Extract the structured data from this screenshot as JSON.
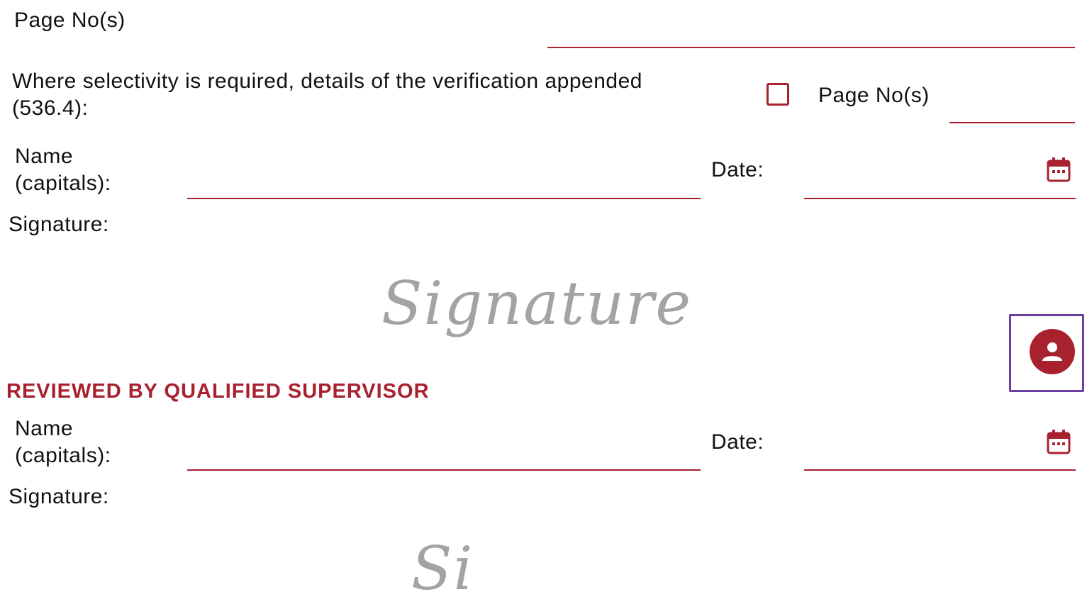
{
  "colors": {
    "accent": "#a8212f",
    "focus_frame": "#6b3fa0",
    "signature_placeholder": "#a3a3a3"
  },
  "top": {
    "page_no_label": "Page No(s)"
  },
  "selectivity": {
    "text_line1": "Where selectivity is required, details of the verification appended",
    "text_line2": "(536.4):",
    "page_no_label": "Page No(s)"
  },
  "signer": {
    "name_label_line1": "Name",
    "name_label_line2": "(capitals):",
    "date_label": "Date:",
    "signature_label": "Signature:",
    "signature_placeholder": "Signature"
  },
  "reviewer": {
    "heading": "REVIEWED BY QUALIFIED SUPERVISOR",
    "name_label_line1": "Name",
    "name_label_line2": "(capitals):",
    "date_label": "Date:",
    "signature_label": "Signature:",
    "signature_placeholder": "Si"
  },
  "icons": {
    "calendar": "calendar-icon",
    "person": "person-icon"
  }
}
